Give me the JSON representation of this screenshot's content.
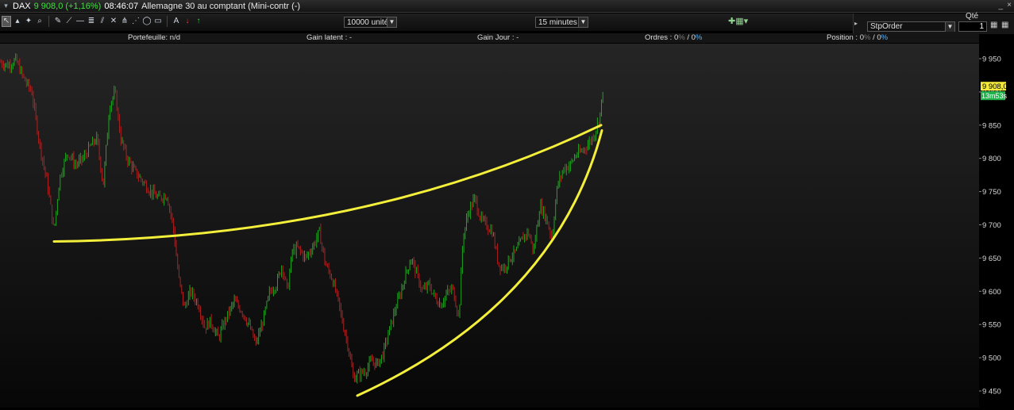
{
  "titlebar": {
    "symbol": "DAX",
    "price_change": "9 908,0 (+1,16%)",
    "time": "08:46:07",
    "description": "Allemagne 30 au comptant (Mini-contr (-)",
    "minimize": "_",
    "close": "×"
  },
  "toolbar": {
    "tools": [
      {
        "name": "cursor-icon",
        "glyph": "↖"
      },
      {
        "name": "flag-icon",
        "glyph": "▴"
      },
      {
        "name": "crosshair-icon",
        "glyph": "✦"
      },
      {
        "name": "zoom-icon",
        "glyph": "⌕"
      },
      {
        "name": "pen-icon",
        "glyph": "✎"
      },
      {
        "name": "line-icon",
        "glyph": "⟋"
      },
      {
        "name": "hline-icon",
        "glyph": "—"
      },
      {
        "name": "fibonacci-icon",
        "glyph": "≣"
      },
      {
        "name": "channel-icon",
        "glyph": "⫽"
      },
      {
        "name": "gann-icon",
        "glyph": "✕"
      },
      {
        "name": "pitchfork-icon",
        "glyph": "⋔"
      },
      {
        "name": "regression-icon",
        "glyph": "⋰"
      },
      {
        "name": "ellipse-icon",
        "glyph": "◯"
      },
      {
        "name": "rectangle-icon",
        "glyph": "▭"
      },
      {
        "name": "text-icon",
        "glyph": "A"
      },
      {
        "name": "arrow-down-icon",
        "glyph": "↓"
      },
      {
        "name": "arrow-up-icon",
        "glyph": "↑"
      }
    ],
    "units": "10000 unités",
    "timeframe": "15 minutes",
    "add_indicator": "✚▦▾"
  },
  "order_panel": {
    "qty_label": "Qté",
    "order_type": "StpOrder",
    "quantity": "1"
  },
  "info_bar": {
    "portfolio": "Portefeuille: n/d",
    "latent": "Gain latent : -",
    "day": "Gain Jour : -",
    "orders_label": "Ordres : 0",
    "orders_dim": "%",
    "orders_sep": " / 0",
    "orders_pct": "%",
    "position_label": "Position : 0",
    "position_dim": "%",
    "position_sep": " / 0",
    "position_pct": "%"
  },
  "colors": {
    "up": "#1fa61f",
    "down": "#b02020",
    "trendline": "#f4ef3a",
    "price_tag": "#f2e93a",
    "timer_tag": "#22b24c"
  },
  "chart_data": {
    "type": "candlestick",
    "instrument": "DAX",
    "timeframe": "15 minutes",
    "ylim": [
      9425,
      9985
    ],
    "y_ticks": [
      "9 950",
      "9 900",
      "9 850",
      "9 800",
      "9 750",
      "9 700",
      "9 650",
      "9 600",
      "9 550",
      "9 500",
      "9 450"
    ],
    "y_tick_values": [
      9950,
      9900,
      9850,
      9800,
      9750,
      9700,
      9650,
      9600,
      9550,
      9500,
      9450
    ],
    "last_price": "9 908,0",
    "last_price_value": 9908,
    "countdown": "13m53s",
    "series_close_points": [
      [
        0,
        9945
      ],
      [
        10,
        9940
      ],
      [
        20,
        9948
      ],
      [
        30,
        9920
      ],
      [
        40,
        9900
      ],
      [
        50,
        9820
      ],
      [
        60,
        9760
      ],
      [
        68,
        9690
      ],
      [
        75,
        9770
      ],
      [
        85,
        9810
      ],
      [
        95,
        9790
      ],
      [
        105,
        9800
      ],
      [
        115,
        9820
      ],
      [
        122,
        9830
      ],
      [
        130,
        9760
      ],
      [
        138,
        9880
      ],
      [
        145,
        9900
      ],
      [
        152,
        9830
      ],
      [
        160,
        9800
      ],
      [
        170,
        9780
      ],
      [
        180,
        9765
      ],
      [
        190,
        9750
      ],
      [
        200,
        9740
      ],
      [
        210,
        9745
      ],
      [
        218,
        9700
      ],
      [
        225,
        9620
      ],
      [
        232,
        9575
      ],
      [
        240,
        9600
      ],
      [
        250,
        9580
      ],
      [
        258,
        9545
      ],
      [
        265,
        9555
      ],
      [
        275,
        9530
      ],
      [
        285,
        9560
      ],
      [
        295,
        9585
      ],
      [
        305,
        9570
      ],
      [
        315,
        9545
      ],
      [
        322,
        9520
      ],
      [
        330,
        9550
      ],
      [
        340,
        9600
      ],
      [
        348,
        9610
      ],
      [
        355,
        9640
      ],
      [
        362,
        9600
      ],
      [
        368,
        9660
      ],
      [
        375,
        9665
      ],
      [
        385,
        9650
      ],
      [
        395,
        9670
      ],
      [
        402,
        9690
      ],
      [
        410,
        9640
      ],
      [
        418,
        9620
      ],
      [
        425,
        9590
      ],
      [
        432,
        9550
      ],
      [
        438,
        9520
      ],
      [
        445,
        9470
      ],
      [
        452,
        9475
      ],
      [
        460,
        9480
      ],
      [
        468,
        9495
      ],
      [
        475,
        9490
      ],
      [
        482,
        9505
      ],
      [
        490,
        9540
      ],
      [
        497,
        9570
      ],
      [
        505,
        9600
      ],
      [
        512,
        9630
      ],
      [
        518,
        9650
      ],
      [
        525,
        9625
      ],
      [
        532,
        9600
      ],
      [
        540,
        9610
      ],
      [
        548,
        9590
      ],
      [
        555,
        9580
      ],
      [
        562,
        9595
      ],
      [
        570,
        9605
      ],
      [
        578,
        9560
      ],
      [
        583,
        9680
      ],
      [
        590,
        9720
      ],
      [
        598,
        9740
      ],
      [
        605,
        9710
      ],
      [
        612,
        9700
      ],
      [
        620,
        9690
      ],
      [
        628,
        9640
      ],
      [
        635,
        9635
      ],
      [
        642,
        9650
      ],
      [
        650,
        9660
      ],
      [
        658,
        9680
      ],
      [
        665,
        9690
      ],
      [
        672,
        9660
      ],
      [
        680,
        9730
      ],
      [
        688,
        9710
      ],
      [
        695,
        9680
      ],
      [
        702,
        9760
      ],
      [
        710,
        9785
      ],
      [
        718,
        9790
      ],
      [
        725,
        9805
      ],
      [
        732,
        9810
      ],
      [
        740,
        9820
      ],
      [
        748,
        9835
      ],
      [
        755,
        9860
      ],
      [
        760,
        9908
      ]
    ],
    "trendlines": [
      {
        "from": [
          68,
          9675
        ],
        "ctrl": [
          460,
          9680
        ],
        "to": [
          757,
          9850
        ]
      },
      {
        "from": [
          450,
          9443
        ],
        "ctrl": [
          700,
          9580
        ],
        "to": [
          758,
          9842
        ]
      }
    ]
  }
}
